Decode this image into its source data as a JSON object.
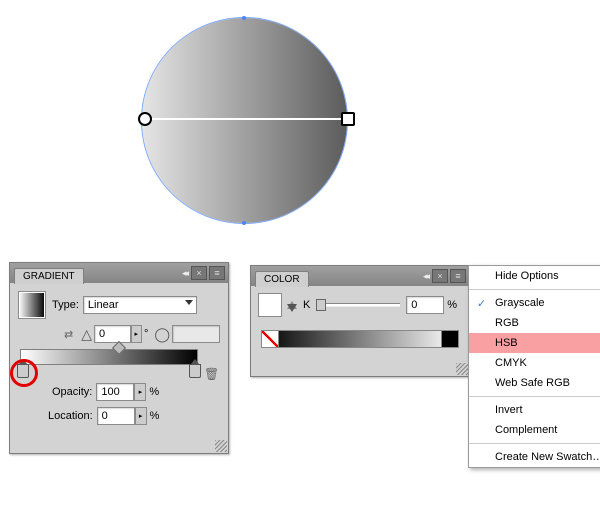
{
  "canvas": {
    "gradient_start": "#e5e5e5",
    "gradient_end": "#5c5c5c",
    "selection_color": "#4c84ff"
  },
  "gradient_panel": {
    "title": "GRADIENT",
    "type_label": "Type:",
    "type_value": "Linear",
    "angle_value": "0",
    "opacity_label": "Opacity:",
    "opacity_value": "100",
    "opacity_unit": "%",
    "location_label": "Location:",
    "location_value": "0",
    "location_unit": "%"
  },
  "color_panel": {
    "title": "COLOR",
    "channel_label": "K",
    "channel_value": "0",
    "channel_unit": "%"
  },
  "menu": {
    "items": [
      {
        "label": "Hide Options",
        "checked": false
      },
      {
        "label": "Grayscale",
        "checked": true
      },
      {
        "label": "RGB",
        "checked": false
      },
      {
        "label": "HSB",
        "checked": false,
        "selected": true
      },
      {
        "label": "CMYK",
        "checked": false
      },
      {
        "label": "Web Safe RGB",
        "checked": false
      },
      {
        "label": "Invert",
        "checked": false
      },
      {
        "label": "Complement",
        "checked": false
      },
      {
        "label": "Create New Swatch…",
        "checked": false
      }
    ]
  }
}
